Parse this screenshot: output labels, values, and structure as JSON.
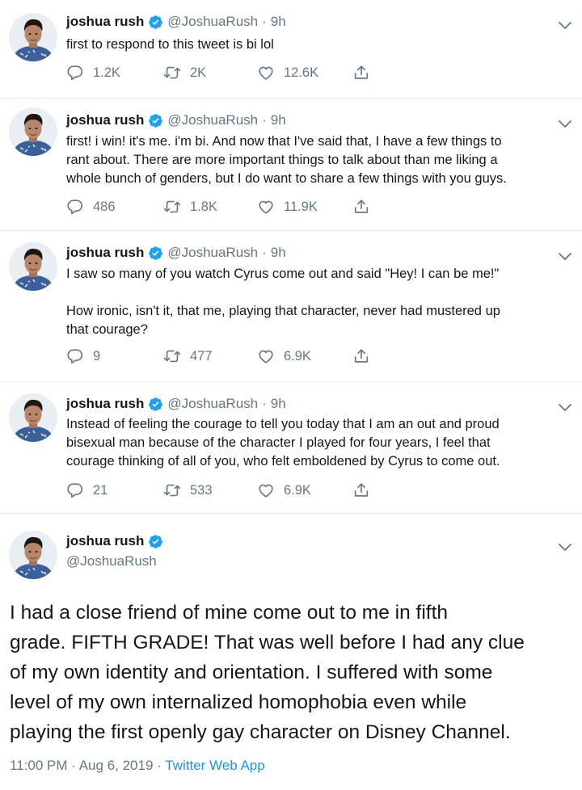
{
  "colors": {
    "verified_blue": "#1da1f2",
    "secondary_text": "#657786",
    "link_blue": "#1b95e0",
    "divider": "#e6ecf0"
  },
  "icons": {
    "verified": "verified-badge-icon",
    "chevron": "chevron-down-icon",
    "reply": "reply-icon",
    "retweet": "retweet-icon",
    "like": "heart-icon",
    "share": "share-icon"
  },
  "tweets": [
    {
      "name": "joshua rush",
      "handle": "@JoshuaRush",
      "separator": "·",
      "time": "9h",
      "lines": [
        "first to respond to this tweet is bi lol"
      ],
      "replies": "1.2K",
      "retweets": "2K",
      "likes": "12.6K"
    },
    {
      "name": "joshua rush",
      "handle": "@JoshuaRush",
      "separator": "·",
      "time": "9h",
      "lines": [
        "first! i win! it's me. i'm bi. And now that I've said that, I have a few things to",
        "rant about. There are more important things to talk about than me liking a",
        "whole bunch of genders, but I do want to share a few things with you guys."
      ],
      "replies": "486",
      "retweets": "1.8K",
      "likes": "11.9K"
    },
    {
      "name": "joshua rush",
      "handle": "@JoshuaRush",
      "separator": "·",
      "time": "9h",
      "lines": [
        "I saw so many of you watch Cyrus come out and said \"Hey! I can be me!\"",
        "",
        "How ironic, isn't it, that me, playing that character, never had mustered up",
        "that courage?"
      ],
      "replies": "9",
      "retweets": "477",
      "likes": "6.9K"
    },
    {
      "name": "joshua rush",
      "handle": "@JoshuaRush",
      "separator": "·",
      "time": "9h",
      "lines": [
        "Instead of feeling the courage to tell you today that I am an out and proud",
        "bisexual man because of the character I played for four years, I feel that",
        "courage thinking of all of you, who felt emboldened by Cyrus to come out."
      ],
      "replies": "21",
      "retweets": "533",
      "likes": "6.9K"
    }
  ],
  "main_tweet": {
    "name": "joshua rush",
    "handle": "@JoshuaRush",
    "lines": [
      "I had a close friend of mine come out to me in fifth",
      "grade. FIFTH GRADE! That was well before I had any clue",
      "of my own identity and orientation. I suffered with some",
      "level of my own internalized homophobia even while",
      "playing the first openly gay character on Disney Channel."
    ],
    "time": "11:00 PM",
    "separator": "·",
    "date": "Aug 6, 2019",
    "source": "Twitter Web App"
  }
}
